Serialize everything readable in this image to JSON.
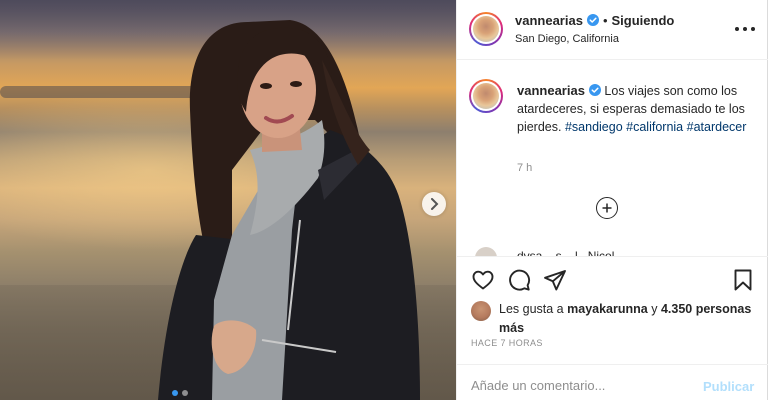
{
  "post": {
    "username": "vannearias",
    "verified": true,
    "follow_status": "Siguiendo",
    "location": "San Diego, California"
  },
  "caption": {
    "username": "vannearias",
    "text": "Los viajes son como los atardeceres, si esperas demasiado te los pierdes.",
    "hashtags": [
      "#sandiego",
      "#california",
      "#atardecer"
    ],
    "time": "7 h"
  },
  "peek_comment": "dvsa ...s ...l.. Nicol",
  "likes": {
    "prefix": "Les gusta a",
    "user": "mayakarunna",
    "conj": "y",
    "others": "4.350 personas más"
  },
  "timestamp": "HACE 7 HORAS",
  "comment_box": {
    "placeholder": "Añade un comentario...",
    "post_label": "Publicar"
  },
  "icons": {
    "more": "more-options-icon",
    "next": "chevron-right-icon",
    "like": "heart-icon",
    "comment": "comment-icon",
    "share": "paper-plane-icon",
    "save": "bookmark-icon",
    "load_more": "plus-circle-icon",
    "verified": "verified-badge-icon"
  },
  "colors": {
    "link": "#00376b",
    "verified": "#3897f0",
    "publish_disabled": "#b2dffc",
    "muted": "#8e8e8e"
  },
  "carousel": {
    "count": 2,
    "active": 1
  }
}
